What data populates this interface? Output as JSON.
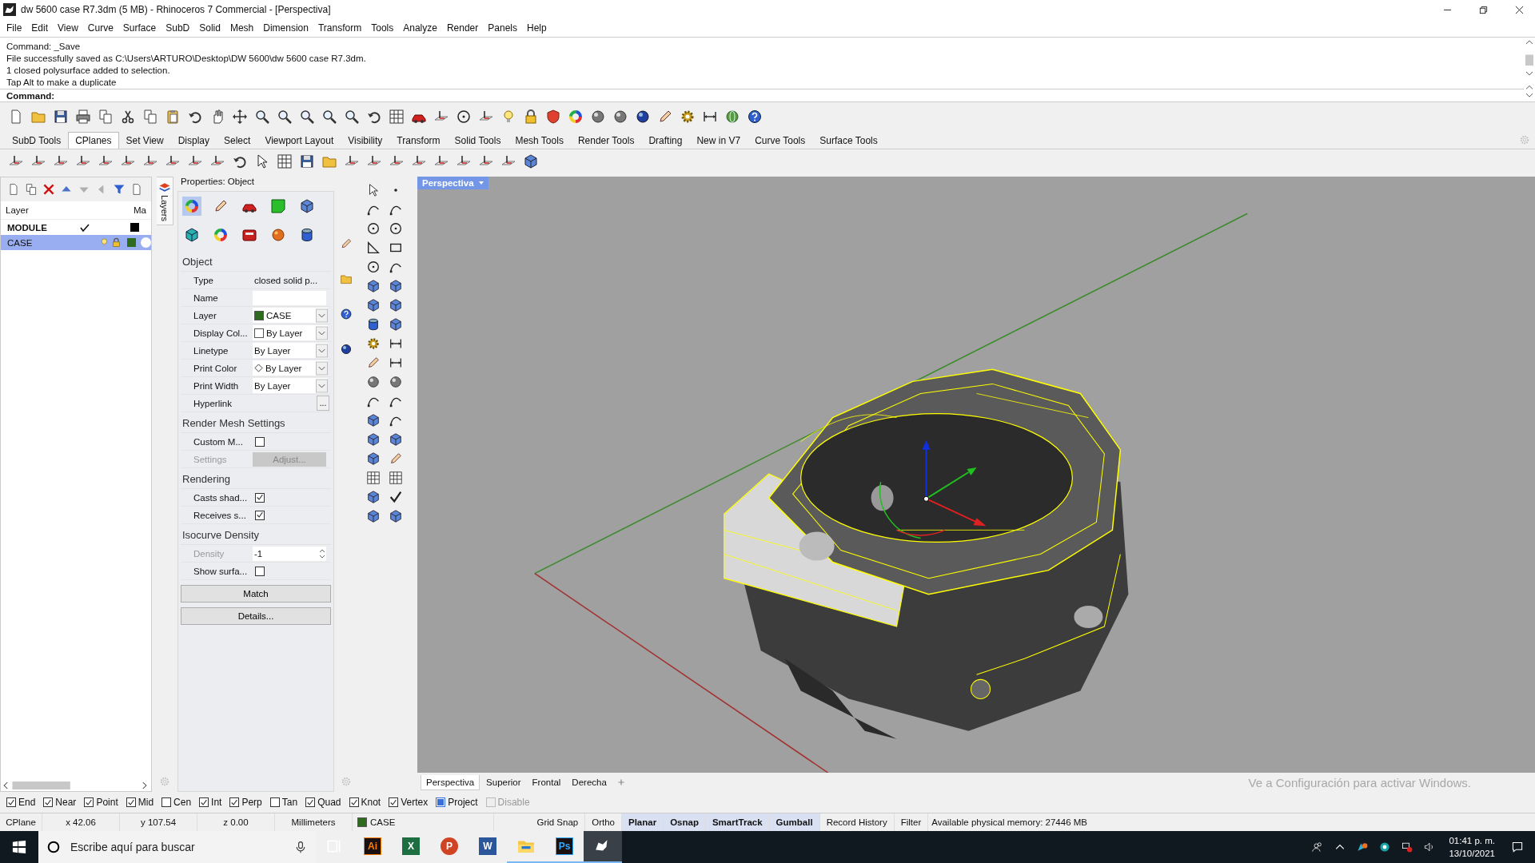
{
  "window": {
    "title": "dw 5600 case R7.3dm (5 MB) - Rhinoceros 7 Commercial - [Perspectiva]"
  },
  "menu": [
    "File",
    "Edit",
    "View",
    "Curve",
    "Surface",
    "SubD",
    "Solid",
    "Mesh",
    "Dimension",
    "Transform",
    "Tools",
    "Analyze",
    "Render",
    "Panels",
    "Help"
  ],
  "command_history": [
    "Command: _Save",
    "File successfully saved as C:\\Users\\ARTURO\\Desktop\\DW 5600\\dw 5600 case R7.3dm.",
    "1 closed polysurface added to selection.",
    "Tap Alt to make a duplicate"
  ],
  "command_prompt": "Command:",
  "toolbar_tabs": [
    {
      "label": "SubD Tools",
      "selected": false
    },
    {
      "label": "CPlanes",
      "selected": true
    },
    {
      "label": "Set View",
      "selected": false
    },
    {
      "label": "Display",
      "selected": false
    },
    {
      "label": "Select",
      "selected": false
    },
    {
      "label": "Viewport Layout",
      "selected": false
    },
    {
      "label": "Visibility",
      "selected": false
    },
    {
      "label": "Transform",
      "selected": false
    },
    {
      "label": "Solid Tools",
      "selected": false
    },
    {
      "label": "Mesh Tools",
      "selected": false
    },
    {
      "label": "Render Tools",
      "selected": false
    },
    {
      "label": "Drafting",
      "selected": false
    },
    {
      "label": "New in V7",
      "selected": false
    },
    {
      "label": "Curve Tools",
      "selected": false
    },
    {
      "label": "Surface Tools",
      "selected": false
    }
  ],
  "layers": {
    "tab": "Layers",
    "columns": [
      "Layer",
      "Ma"
    ],
    "rows": [
      {
        "name": "MODULE",
        "current": true,
        "selected": false,
        "color": "#000000"
      },
      {
        "name": "CASE",
        "current": false,
        "selected": true,
        "color": "#2f6b1e"
      }
    ]
  },
  "properties": {
    "title": "Properties: Object",
    "sections": [
      {
        "title": "Object",
        "rows": [
          {
            "label": "Type",
            "kind": "text",
            "value": "closed solid p...",
            "disabled": false
          },
          {
            "label": "Name",
            "kind": "field",
            "disabled": false
          },
          {
            "label": "Layer",
            "kind": "dropdown",
            "value": "CASE",
            "color": "#2f6b1e",
            "disabled": false
          },
          {
            "label": "Display Col...",
            "kind": "dropdown",
            "value": "By Layer",
            "color": "#ffffff",
            "disabled": false
          },
          {
            "label": "Linetype",
            "kind": "dropdown",
            "value": "By Layer",
            "disabled": false
          },
          {
            "label": "Print Color",
            "kind": "dropdown_diamond",
            "value": "By Layer",
            "disabled": false
          },
          {
            "label": "Print Width",
            "kind": "dropdown",
            "value": "By Layer",
            "disabled": false
          },
          {
            "label": "Hyperlink",
            "kind": "ellipsis",
            "value": "...",
            "disabled": false
          }
        ]
      },
      {
        "title": "Render Mesh Settings",
        "rows": [
          {
            "label": "Custom M...",
            "kind": "checkbox",
            "checked": false,
            "disabled": false
          },
          {
            "label": "Settings",
            "kind": "button",
            "value": "Adjust...",
            "disabled": true
          }
        ]
      },
      {
        "title": "Rendering",
        "rows": [
          {
            "label": "Casts shad...",
            "kind": "checkbox",
            "checked": true,
            "disabled": false
          },
          {
            "label": "Receives s...",
            "kind": "checkbox",
            "checked": true,
            "disabled": false
          }
        ]
      },
      {
        "title": "Isocurve Density",
        "rows": [
          {
            "label": "Density",
            "kind": "spinner",
            "value": "-1",
            "disabled": true
          },
          {
            "label": "Show surfa...",
            "kind": "checkbox",
            "checked": false,
            "disabled": false
          }
        ]
      }
    ],
    "buttons": [
      "Match",
      "Details..."
    ]
  },
  "viewport": {
    "label": "Perspectiva",
    "tabs": [
      {
        "label": "Perspectiva",
        "selected": true
      },
      {
        "label": "Superior",
        "selected": false
      },
      {
        "label": "Frontal",
        "selected": false
      },
      {
        "label": "Derecha",
        "selected": false
      }
    ],
    "activation": "Ve a Configuración para activar Windows."
  },
  "osnaps": [
    {
      "label": "End",
      "kind": "check",
      "checked": true,
      "disabled": false
    },
    {
      "label": "Near",
      "kind": "check",
      "checked": true,
      "disabled": false
    },
    {
      "label": "Point",
      "kind": "check",
      "checked": true,
      "disabled": false
    },
    {
      "label": "Mid",
      "kind": "check",
      "checked": true,
      "disabled": false
    },
    {
      "label": "Cen",
      "kind": "check",
      "checked": false,
      "disabled": false
    },
    {
      "label": "Int",
      "kind": "check",
      "checked": true,
      "disabled": false
    },
    {
      "label": "Perp",
      "kind": "check",
      "checked": true,
      "disabled": false
    },
    {
      "label": "Tan",
      "kind": "check",
      "checked": false,
      "disabled": false
    },
    {
      "label": "Quad",
      "kind": "check",
      "checked": true,
      "disabled": false
    },
    {
      "label": "Knot",
      "kind": "check",
      "checked": true,
      "disabled": false
    },
    {
      "label": "Vertex",
      "kind": "check",
      "checked": true,
      "disabled": false
    },
    {
      "label": "Project",
      "kind": "fill",
      "checked": true,
      "disabled": false
    },
    {
      "label": "Disable",
      "kind": "check",
      "checked": false,
      "disabled": true
    }
  ],
  "status_bar": {
    "cplane": "CPlane",
    "x": "x 42.06",
    "y": "y 107.54",
    "z": "z 0.00",
    "units": "Millimeters",
    "layer": {
      "name": "CASE",
      "color": "#2f6b1e"
    },
    "toggles": [
      {
        "label": "Grid Snap",
        "on": false
      },
      {
        "label": "Ortho",
        "on": false
      },
      {
        "label": "Planar",
        "on": true
      },
      {
        "label": "Osnap",
        "on": true
      },
      {
        "label": "SmartTrack",
        "on": true
      },
      {
        "label": "Gumball",
        "on": true
      },
      {
        "label": "Record History",
        "on": false
      },
      {
        "label": "Filter",
        "on": false
      }
    ],
    "memory": "Available physical memory: 27446 MB"
  },
  "taskbar": {
    "search_placeholder": "Escribe aquí para buscar",
    "apps": [
      {
        "kind": "taskview",
        "open": false,
        "active": false
      },
      {
        "kind": "outline_tile",
        "label": "Ai",
        "color": "#ff7c00",
        "open": false,
        "active": false
      },
      {
        "kind": "tile",
        "label": "X",
        "color": "#1d6f42",
        "open": false,
        "active": false
      },
      {
        "kind": "round_tile",
        "label": "P",
        "color": "#d04423",
        "open": false,
        "active": false
      },
      {
        "kind": "tile",
        "label": "W",
        "color": "#2b579a",
        "open": false,
        "active": false
      },
      {
        "kind": "folder",
        "open": true,
        "active": false
      },
      {
        "kind": "outline_tile",
        "label": "Ps",
        "color": "#31a8ff",
        "open": true,
        "active": false
      },
      {
        "kind": "rhino",
        "open": true,
        "active": true
      }
    ],
    "time": "01:41 p. m.",
    "date": "13/10/2021"
  }
}
